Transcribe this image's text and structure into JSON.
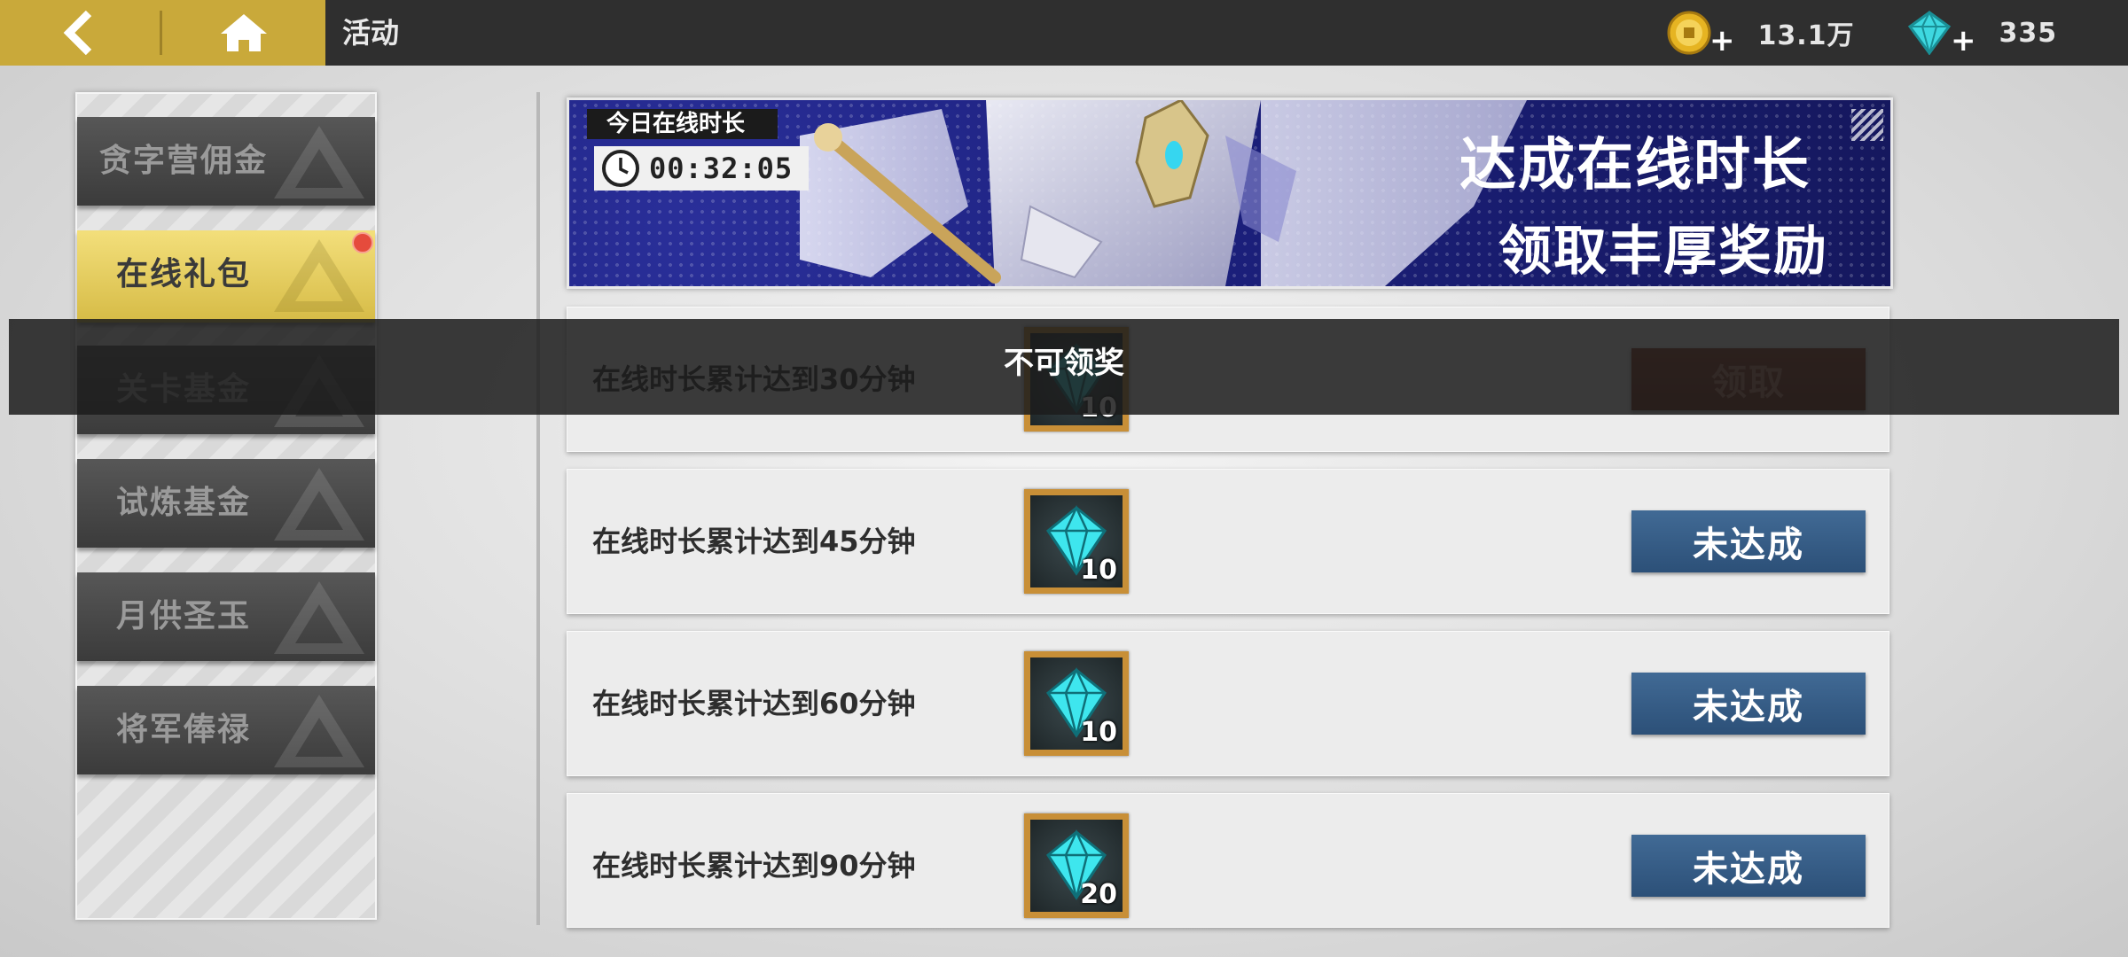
{
  "header": {
    "title": "活动",
    "back_icon": "back-arrow-icon",
    "home_icon": "home-icon",
    "gold": {
      "icon": "gold-coin-icon",
      "plus": "+",
      "amount": "13.1万"
    },
    "gems": {
      "icon": "diamond-icon",
      "plus": "+",
      "amount": "335"
    }
  },
  "sidebar": {
    "items": [
      {
        "label": "贪字营佣金",
        "active": false
      },
      {
        "label": "在线礼包",
        "active": true,
        "notification": true
      },
      {
        "label": "关卡基金",
        "active": false
      },
      {
        "label": "试炼基金",
        "active": false
      },
      {
        "label": "月供圣玉",
        "active": false
      },
      {
        "label": "将军俸禄",
        "active": false
      }
    ]
  },
  "banner": {
    "timer_label": "今日在线时长",
    "timer_value": "00:32:05",
    "headline_1": "达成在线时长",
    "headline_2": "领取丰厚奖励"
  },
  "rows": [
    {
      "condition": "在线时长累计达到30分钟",
      "reward_icon": "diamond-icon",
      "reward_qty": "10",
      "button": "领取",
      "state": "claimable"
    },
    {
      "condition": "在线时长累计达到45分钟",
      "reward_icon": "diamond-icon",
      "reward_qty": "10",
      "button": "未达成",
      "state": "locked"
    },
    {
      "condition": "在线时长累计达到60分钟",
      "reward_icon": "diamond-icon",
      "reward_qty": "10",
      "button": "未达成",
      "state": "locked"
    },
    {
      "condition": "在线时长累计达到90分钟",
      "reward_icon": "diamond-icon",
      "reward_qty": "20",
      "button": "未达成",
      "state": "locked"
    }
  ],
  "toast": {
    "message": "不可领奖"
  },
  "colors": {
    "accent_gold": "#c9a93a",
    "active_tab": "#e8cf5c",
    "button_blue": "#3a6290",
    "claim_red": "#7a2f1c",
    "notification_red": "#e54b3c",
    "gem_cyan": "#3ee6ee",
    "frame_gold": "#c88f37"
  }
}
